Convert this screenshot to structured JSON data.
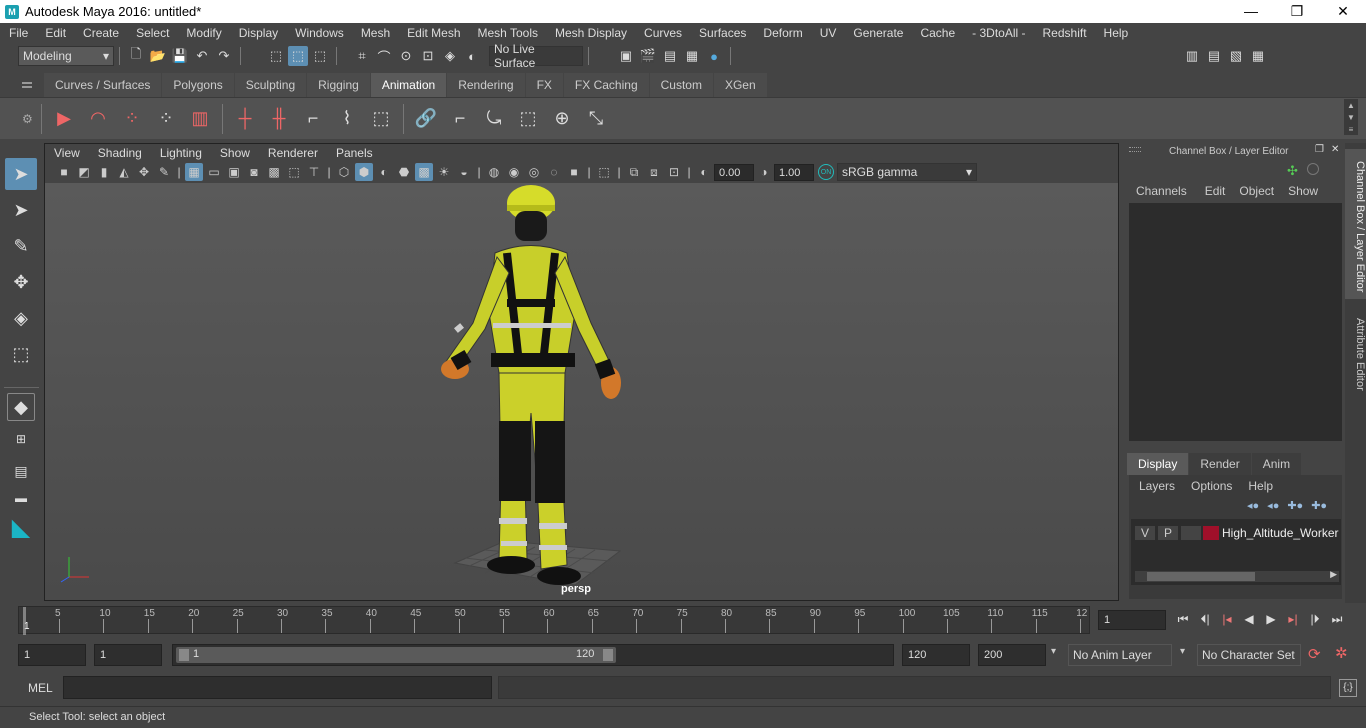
{
  "window": {
    "title": "Autodesk Maya 2016: untitled*",
    "logo_letter": "M",
    "minimize": "—",
    "restore": "❐",
    "close": "✕"
  },
  "menus": [
    "File",
    "Edit",
    "Create",
    "Select",
    "Modify",
    "Display",
    "Windows",
    "Mesh",
    "Edit Mesh",
    "Mesh Tools",
    "Mesh Display",
    "Curves",
    "Surfaces",
    "Deform",
    "UV",
    "Generate",
    "Cache",
    "- 3DtoAll -",
    "Redshift",
    "Help"
  ],
  "statusline": {
    "mode": "Modeling",
    "live_surface": "No Live Surface"
  },
  "shelf": {
    "tabs": [
      "Curves / Surfaces",
      "Polygons",
      "Sculpting",
      "Rigging",
      "Animation",
      "Rendering",
      "FX",
      "FX Caching",
      "Custom",
      "XGen"
    ],
    "active_tab": "Animation"
  },
  "viewport": {
    "menus": [
      "View",
      "Shading",
      "Lighting",
      "Show",
      "Renderer",
      "Panels"
    ],
    "exposure": "0.00",
    "gamma": "1.00",
    "color_space": "sRGB gamma",
    "camera_label": "persp"
  },
  "channel_box": {
    "title": "Channel Box / Layer Editor",
    "menus": [
      "Channels",
      "Edit",
      "Object",
      "Show"
    ],
    "layer_tabs": [
      "Display",
      "Render",
      "Anim"
    ],
    "active_layer_tab": "Display",
    "layer_menus": [
      "Layers",
      "Options",
      "Help"
    ],
    "layer": {
      "visible": "V",
      "playback": "P",
      "name": "High_Altitude_Worker",
      "color": "#a0102a"
    },
    "side_tabs": [
      "Channel Box / Layer Editor",
      "Attribute Editor"
    ]
  },
  "timeline": {
    "ticks": [
      "5",
      "10",
      "15",
      "20",
      "25",
      "30",
      "35",
      "40",
      "45",
      "50",
      "55",
      "60",
      "65",
      "70",
      "75",
      "80",
      "85",
      "90",
      "95",
      "100",
      "105",
      "110",
      "115",
      "12"
    ],
    "current_frame_marker": "1",
    "current_frame": "1"
  },
  "range": {
    "start": "1",
    "playback_start": "1",
    "slider_start": "1",
    "slider_end": "120",
    "playback_end": "120",
    "end": "200",
    "anim_layer": "No Anim Layer",
    "character_set": "No Character Set"
  },
  "mel": {
    "label": "MEL"
  },
  "help_line": "Select Tool: select an object"
}
